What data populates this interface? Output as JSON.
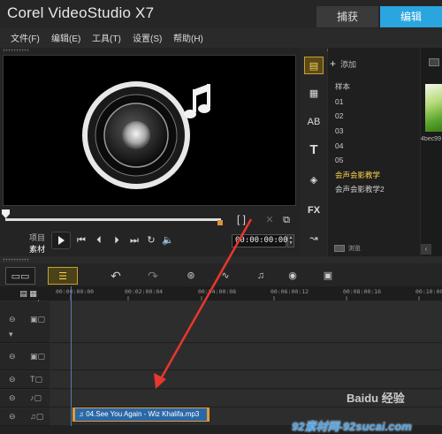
{
  "app": {
    "title": "Corel VideoStudio X7"
  },
  "mode_tabs": {
    "capture": "捕获",
    "edit": "编辑"
  },
  "menu": [
    "文件(F)",
    "编辑(E)",
    "工具(T)",
    "设置(S)",
    "帮助(H)"
  ],
  "player": {
    "mode_project": "项目",
    "mode_clip": "素材",
    "timecode": "00:00:00:00"
  },
  "library": {
    "add_label": "添加",
    "items": [
      "样本",
      "01",
      "02",
      "03",
      "04",
      "05",
      "会声会影教学",
      "会声会影教学2"
    ],
    "selected_index": 6,
    "browse_label": "浏览",
    "thumbnail_label": "4bec99"
  },
  "timeline": {
    "ruler_labels": [
      "00:00:00:00",
      "00:02:00:04",
      "00:04:00:08",
      "00:06:00:12",
      "00:08:00:16",
      "00:10:00"
    ],
    "music_clip": "04.See You Again - Wiz Khalifa.mp3"
  },
  "watermarks": {
    "baidu": "Baidu 经验",
    "site": "92素材网-92sucai.com"
  },
  "colors": {
    "accent": "#2aa5e0",
    "clip": "#2a68a8",
    "clip_border": "#e29a3a",
    "selected_item": "#ffd24d",
    "arrow": "#e8372f"
  }
}
